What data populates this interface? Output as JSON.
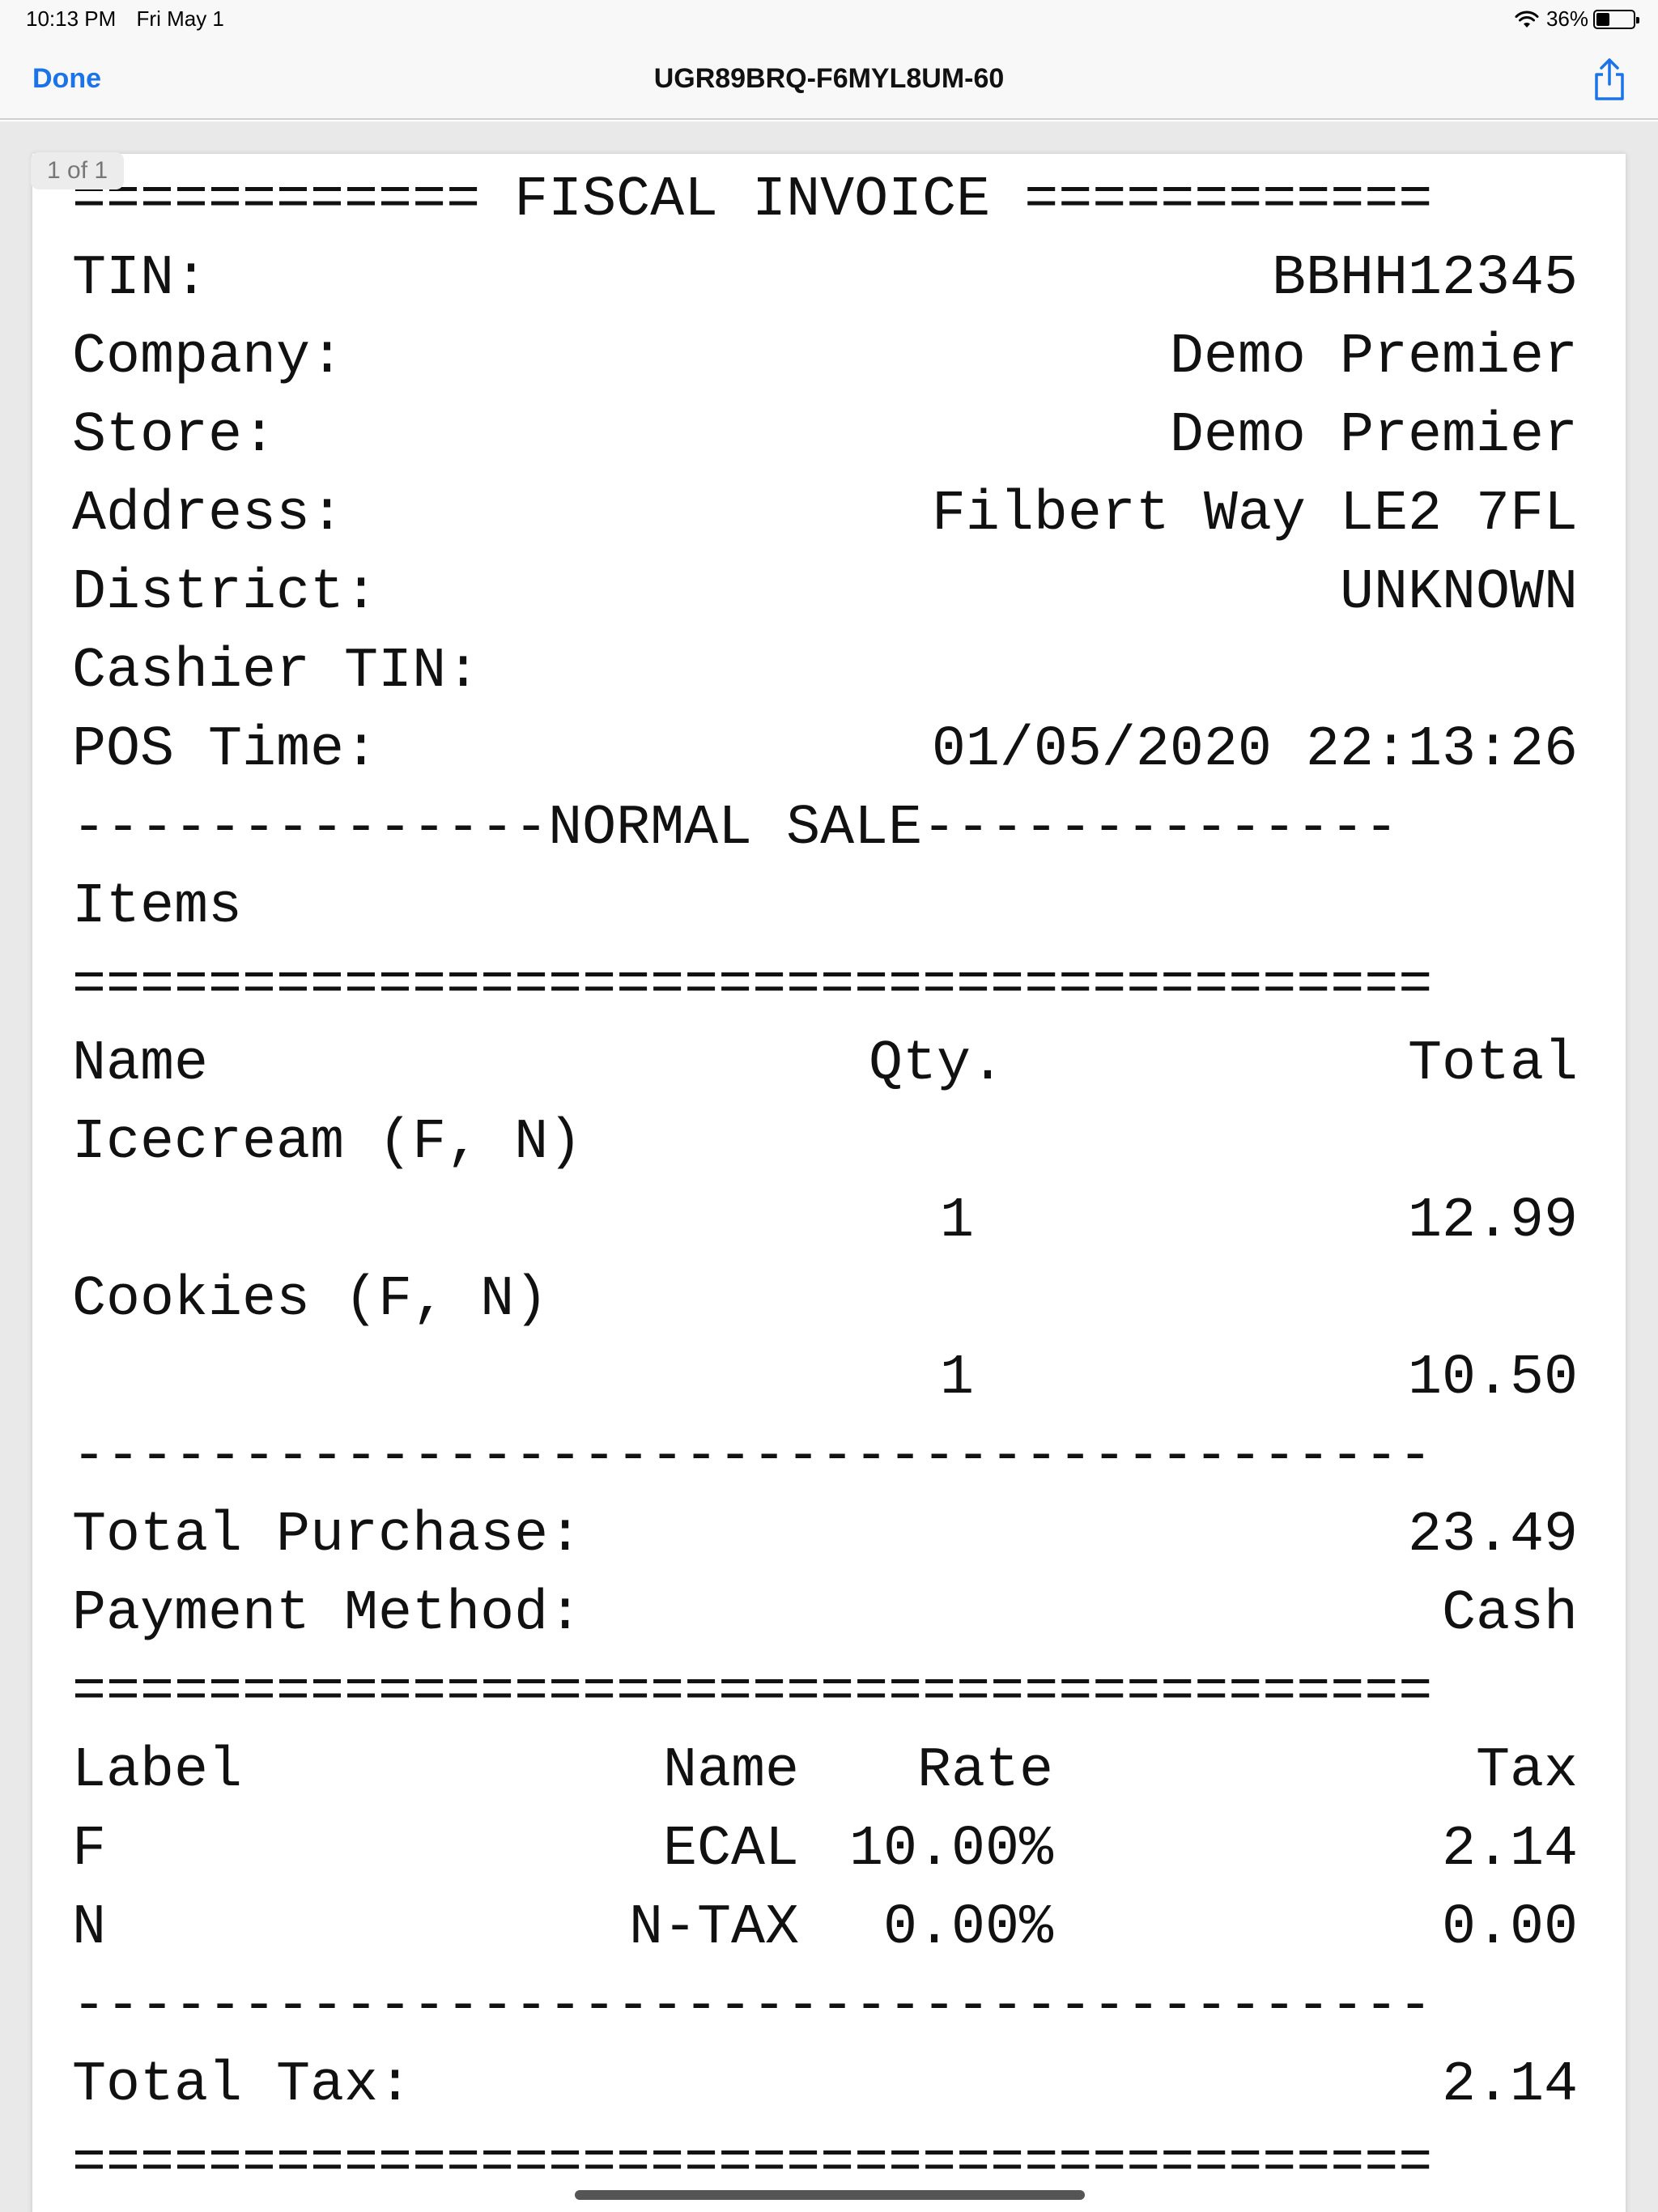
{
  "status_bar": {
    "time": "10:13 PM",
    "date": "Fri May 1",
    "battery": "36%",
    "battery_level": 0.36
  },
  "nav": {
    "done_label": "Done",
    "title": "UGR89BRQ-F6MYL8UM-60",
    "accent_color": "#1a73e8"
  },
  "viewer": {
    "page_indicator": "1 of 1"
  },
  "receipt": {
    "header_rule": "============ FISCAL INVOICE ============",
    "fields": [
      {
        "label": "TIN:",
        "value": "BBHH12345"
      },
      {
        "label": "Company:",
        "value": "Demo Premier"
      },
      {
        "label": "Store:",
        "value": "Demo Premier"
      },
      {
        "label": "Address:",
        "value": "Filbert Way LE2 7FL"
      },
      {
        "label": "District:",
        "value": "UNKNOWN"
      },
      {
        "label": "Cashier TIN:",
        "value": ""
      },
      {
        "label": "POS Time:",
        "value": "01/05/2020 22:13:26"
      }
    ],
    "sale_rule": "--------------NORMAL SALE--------------",
    "items_label": "Items",
    "double_rule": "========================================",
    "single_rule": "----------------------------------------",
    "item_headers": {
      "name": "Name",
      "qty": "Qty.",
      "total": "Total"
    },
    "items": [
      {
        "name": "Icecream (F, N)",
        "qty": "1",
        "total": "12.99"
      },
      {
        "name": "Cookies (F, N)",
        "qty": "1",
        "total": "10.50"
      }
    ],
    "total_purchase_label": "Total Purchase:",
    "total_purchase_value": "23.49",
    "payment_label": "Payment Method:",
    "payment_value": "Cash",
    "tax_headers": {
      "label": "Label",
      "name": "Name",
      "rate": "Rate",
      "tax": "Tax"
    },
    "taxes": [
      {
        "label": "F",
        "name": "ECAL",
        "rate": "10.00%",
        "tax": "2.14"
      },
      {
        "label": "N",
        "name": "N-TAX",
        "rate": "0.00%",
        "tax": "0.00"
      }
    ],
    "total_tax_label": "Total Tax:",
    "total_tax_value": "2.14"
  }
}
